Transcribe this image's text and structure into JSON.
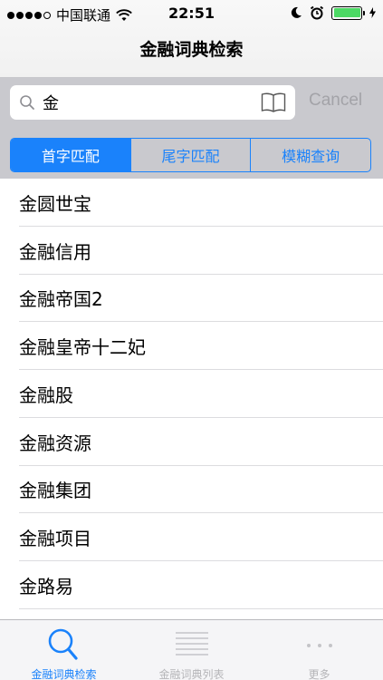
{
  "status_bar": {
    "carrier": "中国联通",
    "time": "22:51"
  },
  "header": {
    "title": "金融词典检索"
  },
  "search": {
    "value": "金",
    "cancel_label": "Cancel"
  },
  "segments": [
    {
      "label": "首字匹配",
      "selected": true
    },
    {
      "label": "尾字匹配",
      "selected": false
    },
    {
      "label": "模糊查询",
      "selected": false
    }
  ],
  "results": [
    "金圆世宝",
    "金融信用",
    "金融帝国2",
    "金融皇帝十二妃",
    "金融股",
    "金融资源",
    "金融集团",
    "金融项目",
    "金路易"
  ],
  "tabbar": {
    "items": [
      {
        "label": "金融词典检索",
        "icon": "search-icon",
        "active": true
      },
      {
        "label": "金融词典列表",
        "icon": "list-icon",
        "active": false
      },
      {
        "label": "更多",
        "icon": "more-icon",
        "active": false
      }
    ]
  },
  "colors": {
    "accent": "#1a82fb",
    "battery": "#4cd964",
    "search_band": "#c9c9ce"
  }
}
